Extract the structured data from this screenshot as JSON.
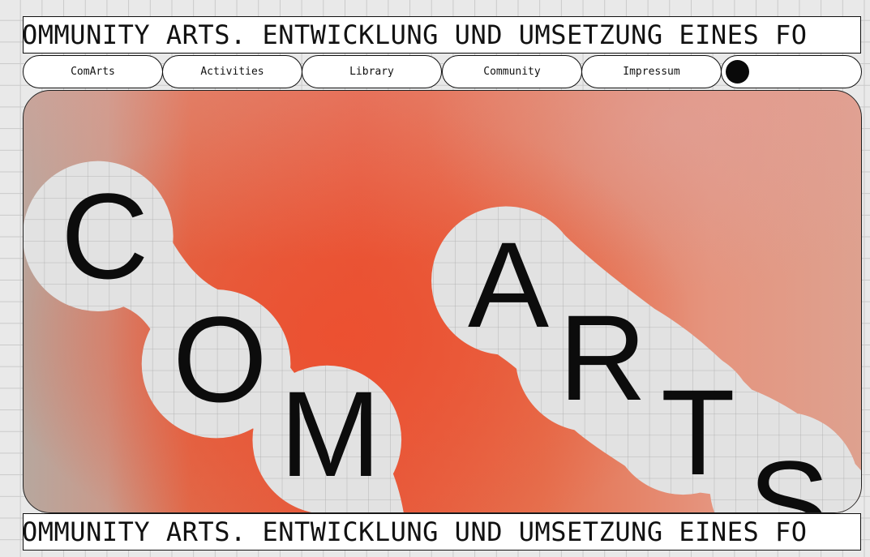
{
  "ticker": {
    "top_text": "OMMUNITY ARTS. ENTWICKLUNG UND UMSETZUNG EINES FO",
    "bottom_text": "OMMUNITY ARTS. ENTWICKLUNG UND UMSETZUNG EINES FO"
  },
  "nav": {
    "items": [
      {
        "label": "ComArts"
      },
      {
        "label": "Activities"
      },
      {
        "label": "Library"
      },
      {
        "label": "Community"
      },
      {
        "label": "Impressum"
      }
    ],
    "toggle_icon": "black-dot-toggle-icon"
  },
  "hero": {
    "letters": [
      "C",
      "O",
      "M",
      "A",
      "R",
      "T",
      "S"
    ],
    "colors": {
      "accent": "#e7583a",
      "blob_fill": "#e2e2e2",
      "text": "#0c0c0c"
    }
  }
}
